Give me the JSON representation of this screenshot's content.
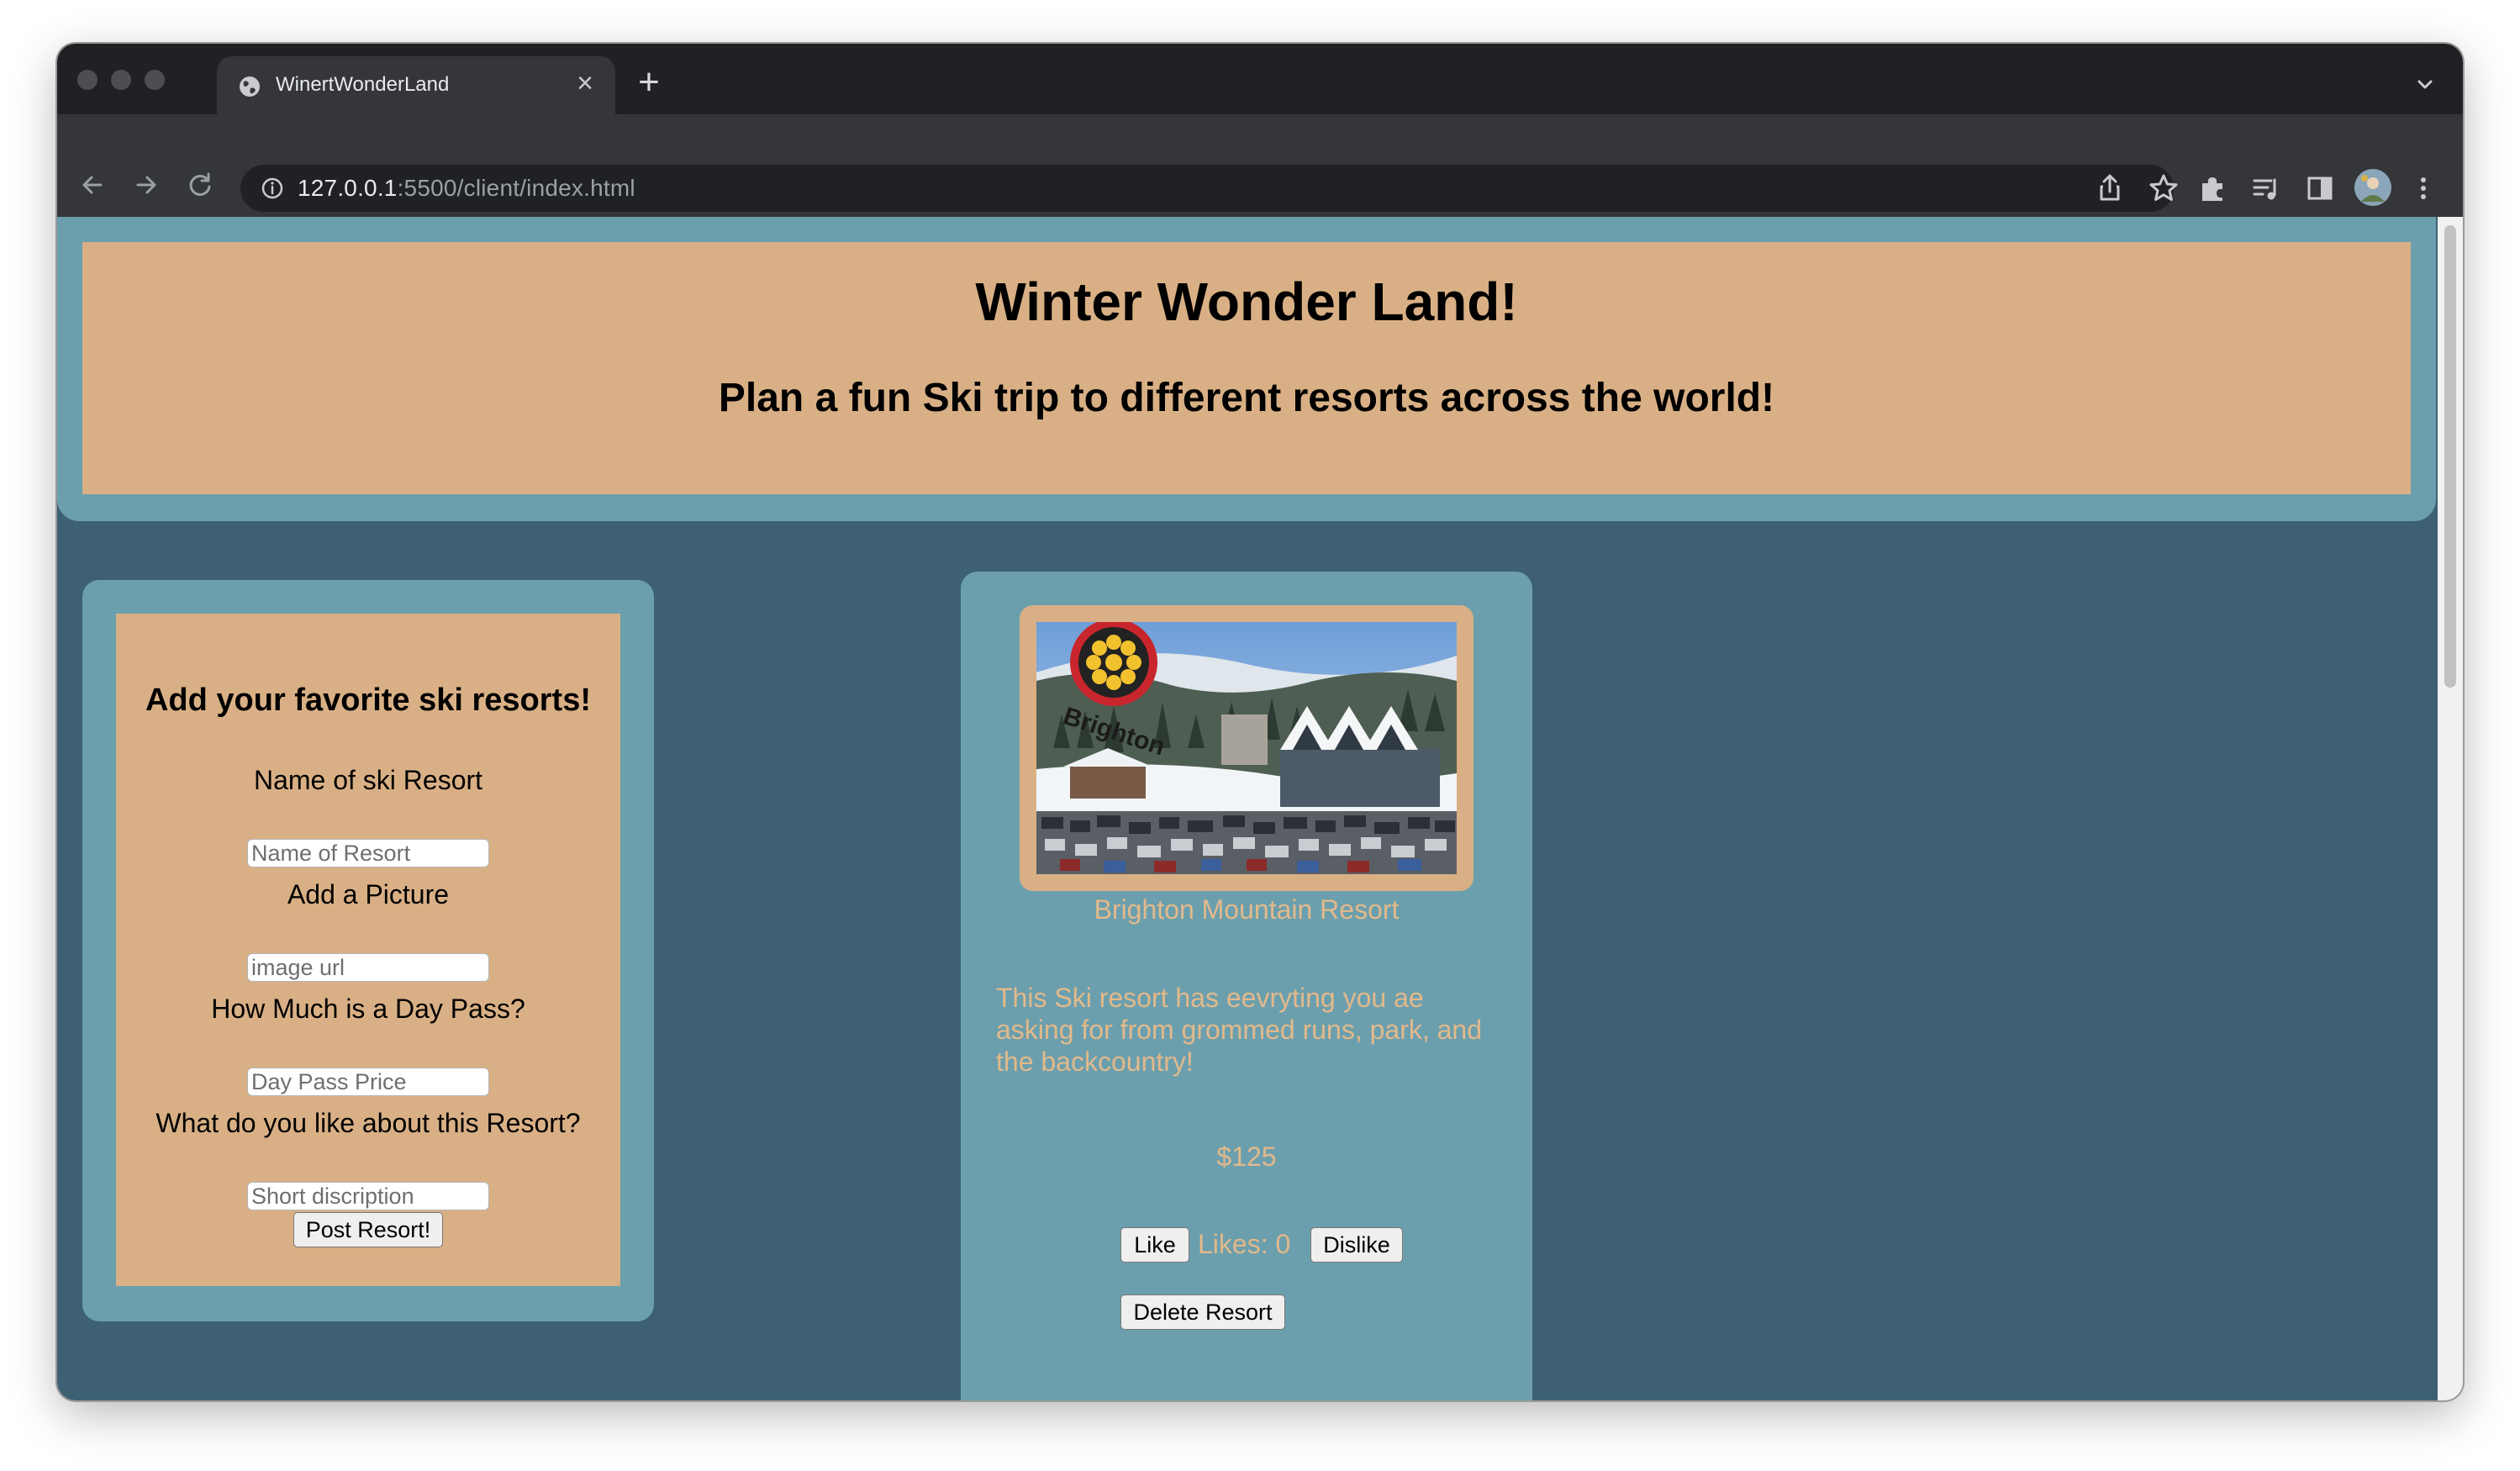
{
  "browser": {
    "tab_title": "WinertWonderLand",
    "url_host": "127.0.0.1",
    "url_rest": ":5500/client/index.html"
  },
  "header": {
    "title": "Winter Wonder Land!",
    "subtitle": "Plan a fun Ski trip to different resorts across the world!"
  },
  "form": {
    "heading": "Add your favorite ski resorts!",
    "name_label": "Name of ski Resort",
    "name_placeholder": "Name of Resort",
    "picture_label": "Add a Picture",
    "picture_placeholder": "image url",
    "price_label": "How Much is a Day Pass?",
    "price_placeholder": "Day Pass Price",
    "description_label": "What do you like about this Resort?",
    "description_placeholder": "Short discription",
    "submit_label": "Post Resort!"
  },
  "resort": {
    "name": "Brighton Mountain Resort",
    "description": "This Ski resort has eevryting you ae asking for from grommed runs, park, and the backcountry!",
    "price": "$125",
    "like_label": "Like",
    "likes_text": "Likes: 0",
    "dislike_label": "Dislike",
    "delete_label": "Delete Resort",
    "photo_sign_text": "Brighton"
  },
  "colors": {
    "page_background": "#3d6172",
    "card_blue": "#6c9fad",
    "card_tan": "#d9b085",
    "card_text": "#e2b98b"
  },
  "icons": [
    "globe-icon",
    "close-icon",
    "plus-icon",
    "chevron-down-icon",
    "back-arrow-icon",
    "forward-arrow-icon",
    "reload-icon",
    "info-icon",
    "share-icon",
    "star-icon",
    "puzzle-icon",
    "media-icon",
    "side-panel-icon",
    "profile-avatar",
    "kebab-menu-icon"
  ]
}
